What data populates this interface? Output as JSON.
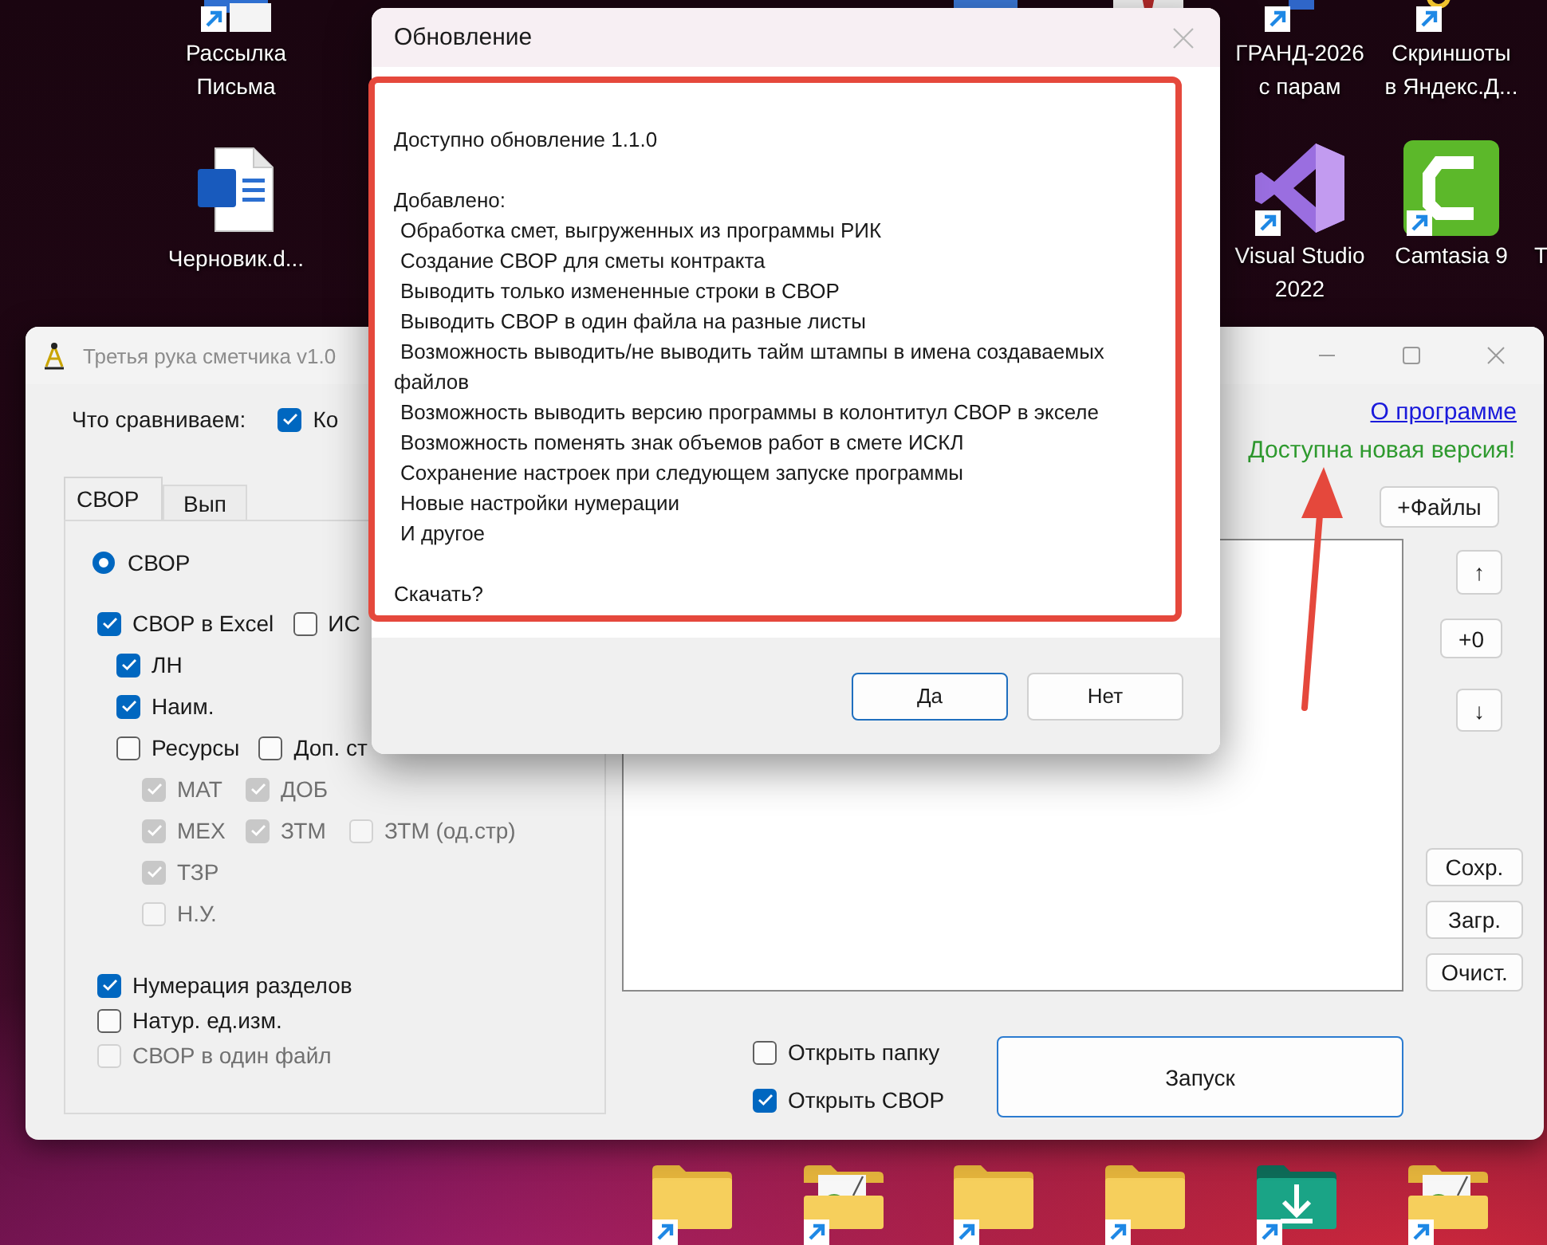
{
  "desktop_icons": [
    {
      "kind": "mail-app",
      "label": "Рассылка\nПисьма",
      "shortcut": true
    },
    {
      "kind": "blue-app",
      "shortcut": false
    },
    {
      "kind": "red-app",
      "shortcut": false
    },
    {
      "kind": "cubes-app",
      "label": "ГРАНД-2026\nс парам",
      "shortcut": true
    },
    {
      "kind": "scissors-app",
      "label": "Скриншоты\nв Яндекс.Д...",
      "shortcut": true
    },
    {
      "kind": "word-document",
      "label": "Черновик.d...",
      "shortcut": false
    },
    {
      "kind": "visual-studio",
      "label": "Visual Studio\n2022",
      "shortcut": true
    },
    {
      "kind": "camtasia",
      "label": "Camtasia 9",
      "shortcut": true
    },
    {
      "kind": "unknown",
      "label": "T"
    }
  ],
  "bottom_icons": [
    {
      "kind": "folder"
    },
    {
      "kind": "image-folder"
    },
    {
      "kind": "folder"
    },
    {
      "kind": "folder"
    },
    {
      "kind": "download-folder"
    },
    {
      "kind": "image-folder"
    }
  ],
  "main_window": {
    "title": "Третья рука сметчика v1.0",
    "compare": {
      "label": "Что сравниваем:",
      "checkbox": {
        "label": "Ко",
        "checked": true
      }
    },
    "tabs": [
      {
        "label": "СВОР",
        "selected": true
      },
      {
        "label": "Вып",
        "selected": false
      }
    ],
    "svor_panel": {
      "radio": {
        "label": "СВОР",
        "selected": true
      },
      "rows": [
        {
          "items": [
            {
              "label": "СВОР в Excel",
              "checked": true,
              "disabled": false
            },
            {
              "label": "ИС",
              "checked": false,
              "disabled": false
            }
          ],
          "children": [
            {
              "items": [
                {
                  "label": "ЛН",
                  "checked": true,
                  "disabled": false
                }
              ]
            },
            {
              "items": [
                {
                  "label": "Наим.",
                  "checked": true,
                  "disabled": false
                }
              ]
            },
            {
              "items": [
                {
                  "label": "Ресурсы",
                  "checked": false,
                  "disabled": false
                },
                {
                  "label": "Доп. ст",
                  "checked": false,
                  "disabled": false
                }
              ],
              "children": [
                {
                  "items": [
                    {
                      "label": "МАТ",
                      "checked": true,
                      "disabled": true
                    },
                    {
                      "label": "ДОБ",
                      "checked": true,
                      "disabled": true
                    }
                  ]
                },
                {
                  "items": [
                    {
                      "label": "МЕХ",
                      "checked": true,
                      "disabled": true
                    },
                    {
                      "label": "ЗТМ",
                      "checked": true,
                      "disabled": true
                    },
                    {
                      "label": "ЗТМ (од.стр)",
                      "checked": false,
                      "disabled": true
                    }
                  ]
                },
                {
                  "items": [
                    {
                      "label": "ТЗР",
                      "checked": true,
                      "disabled": true
                    }
                  ]
                },
                {
                  "items": [
                    {
                      "label": "Н.У.",
                      "checked": false,
                      "disabled": true
                    }
                  ]
                }
              ]
            }
          ]
        }
      ],
      "options": [
        {
          "label": "Нумерация разделов",
          "checked": true,
          "disabled": false
        },
        {
          "label": "Натур. ед.изм.",
          "checked": false,
          "disabled": false
        },
        {
          "label": "СВОР в один файл",
          "checked": false,
          "disabled": true
        }
      ]
    },
    "about_link": "О программе",
    "update_notice": "Доступна новая версия!",
    "add_files_button": "+Файлы",
    "move_buttons": [
      "↑",
      "+0",
      "↓"
    ],
    "list_buttons": [
      "Сохр.",
      "Загр.",
      "Очист."
    ],
    "open_options": [
      {
        "label": "Открыть папку",
        "checked": false
      },
      {
        "label": "Открыть СВОР",
        "checked": true
      }
    ],
    "run_button": "Запуск"
  },
  "dialog": {
    "title": "Обновление",
    "message": {
      "intro": "Доступно обновление 1.1.0",
      "added_label": "Добавлено:",
      "items": [
        "Обработка смет, выгруженных из программы РИК",
        "Создание СВОР для сметы контракта",
        "Выводить только измененные строки в СВОР",
        "Выводить СВОР в один файла на разные листы",
        "Возможность выводить/не выводить тайм штампы в имена создаваемых файлов",
        "Возможность выводить версию программы в колонтитул СВОР в экселе",
        "Возможность поменять знак объемов работ в смете ИСКЛ",
        "Сохранение настроек при следующем запуске программы",
        "Новые настройки нумерации",
        "И другое"
      ],
      "question": "Скачать?"
    },
    "buttons": [
      {
        "label": "Да",
        "default": true
      },
      {
        "label": "Нет",
        "default": false
      }
    ]
  }
}
